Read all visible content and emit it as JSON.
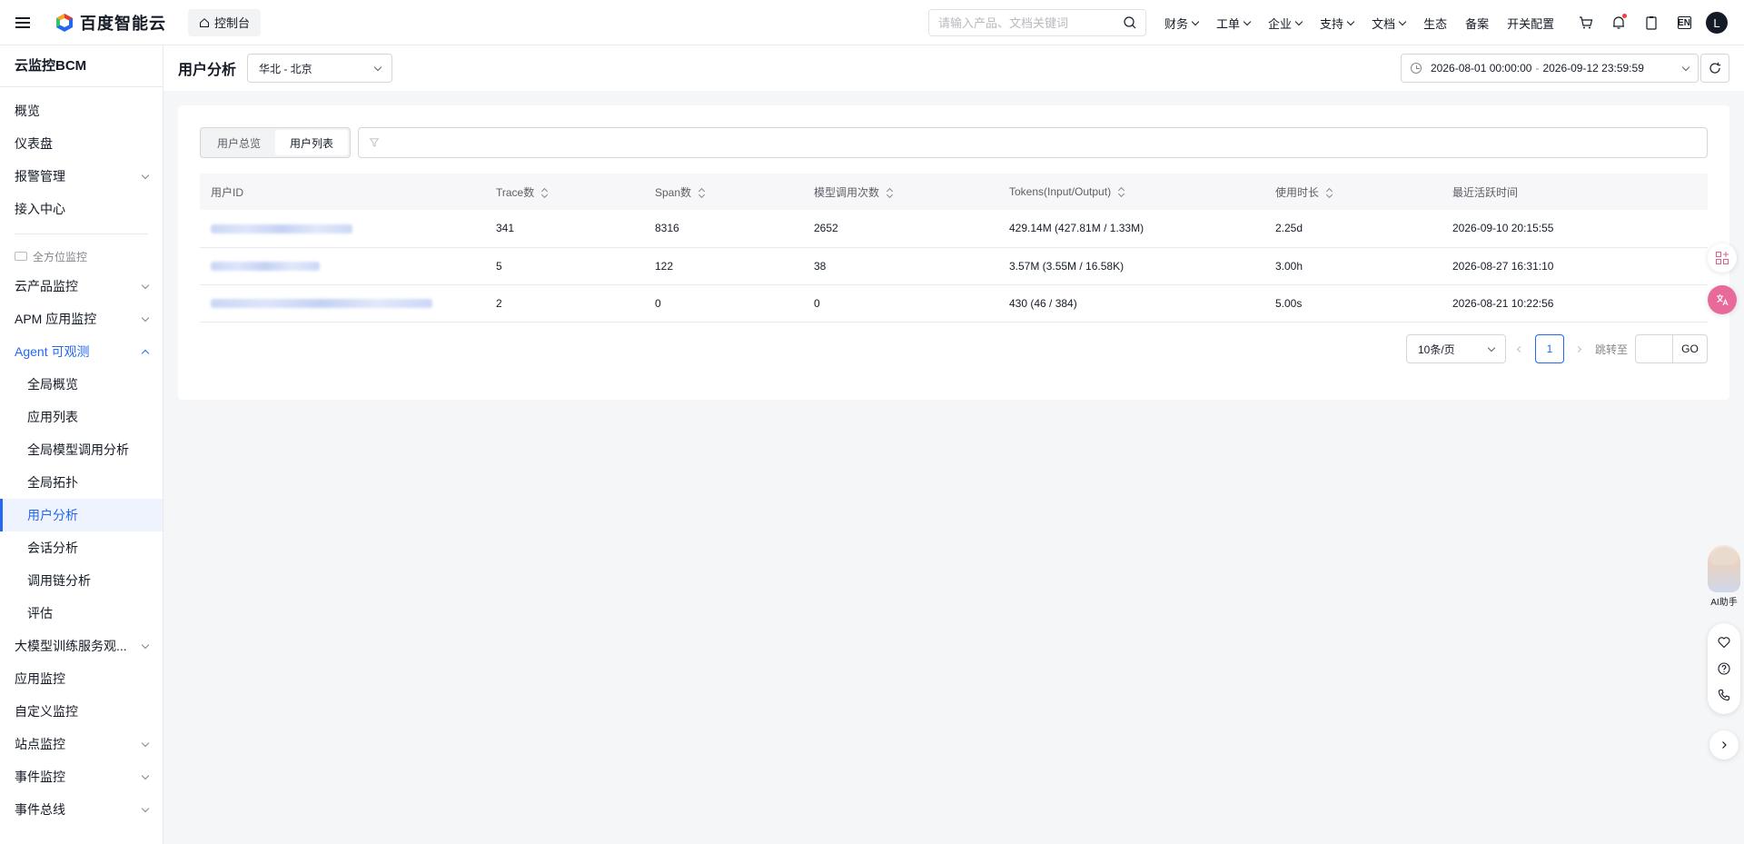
{
  "topbar": {
    "brand": "百度智能云",
    "console_label": "控制台",
    "search_placeholder": "请输入产品、文档关键词",
    "nav": [
      {
        "label": "财务",
        "dropdown": true
      },
      {
        "label": "工单",
        "dropdown": true
      },
      {
        "label": "企业",
        "dropdown": true
      },
      {
        "label": "支持",
        "dropdown": true
      },
      {
        "label": "文档",
        "dropdown": true
      },
      {
        "label": "生态",
        "dropdown": false
      },
      {
        "label": "备案",
        "dropdown": false
      },
      {
        "label": "开关配置",
        "dropdown": false
      }
    ],
    "lang": "EN",
    "avatar_initial": "L"
  },
  "sidebar": {
    "title": "云监控BCM",
    "items_top": [
      {
        "label": "概览"
      },
      {
        "label": "仪表盘"
      },
      {
        "label": "报警管理",
        "chevron": true
      },
      {
        "label": "接入中心"
      }
    ],
    "group_label": "全方位监控",
    "items_main": [
      {
        "label": "云产品监控",
        "chevron": true
      },
      {
        "label": "APM 应用监控",
        "chevron": true
      },
      {
        "label": "Agent 可观测",
        "chevron": true,
        "open": true
      }
    ],
    "agent_children": [
      {
        "label": "全局概览"
      },
      {
        "label": "应用列表"
      },
      {
        "label": "全局模型调用分析"
      },
      {
        "label": "全局拓扑"
      },
      {
        "label": "用户分析",
        "active": true
      },
      {
        "label": "会话分析"
      },
      {
        "label": "调用链分析"
      },
      {
        "label": "评估"
      }
    ],
    "items_bottom": [
      {
        "label": "大模型训练服务观...",
        "chevron": true
      },
      {
        "label": "应用监控"
      },
      {
        "label": "自定义监控"
      },
      {
        "label": "站点监控",
        "chevron": true
      },
      {
        "label": "事件监控",
        "chevron": true
      },
      {
        "label": "事件总线",
        "chevron": true
      }
    ]
  },
  "header": {
    "title": "用户分析",
    "region": "华北 - 北京",
    "time_start": "2026-08-01 00:00:00",
    "time_sep": "-",
    "time_end": "2026-09-12 23:59:59"
  },
  "main": {
    "tabs": [
      {
        "label": "用户总览",
        "active": false
      },
      {
        "label": "用户列表",
        "active": true
      }
    ],
    "filter_placeholder": "",
    "table": {
      "columns": [
        {
          "label": "用户ID",
          "sortable": false
        },
        {
          "label": "Trace数",
          "sortable": true
        },
        {
          "label": "Span数",
          "sortable": true
        },
        {
          "label": "模型调用次数",
          "sortable": true
        },
        {
          "label": "Tokens(Input/Output)",
          "sortable": true
        },
        {
          "label": "使用时长",
          "sortable": true
        },
        {
          "label": "最近活跃时间",
          "sortable": false
        }
      ],
      "rows": [
        {
          "trace": "341",
          "span": "8316",
          "calls": "2652",
          "tokens": "429.14M (427.81M / 1.33M)",
          "duration": "2.25d",
          "last_active": "2026-09-10 20:15:55"
        },
        {
          "trace": "5",
          "span": "122",
          "calls": "38",
          "tokens": "3.57M (3.55M / 16.58K)",
          "duration": "3.00h",
          "last_active": "2026-08-27 16:31:10"
        },
        {
          "trace": "2",
          "span": "0",
          "calls": "0",
          "tokens": "430 (46 / 384)",
          "duration": "5.00s",
          "last_active": "2026-08-21 10:22:56"
        }
      ]
    },
    "pager": {
      "page_size": "10条/页",
      "current_page": "1",
      "jump_label": "跳转至",
      "go_label": "GO"
    }
  },
  "float": {
    "ai_label": "AI助手"
  },
  "colors": {
    "accent": "#2468f2",
    "text": "#151b26",
    "muted": "#84868c"
  }
}
